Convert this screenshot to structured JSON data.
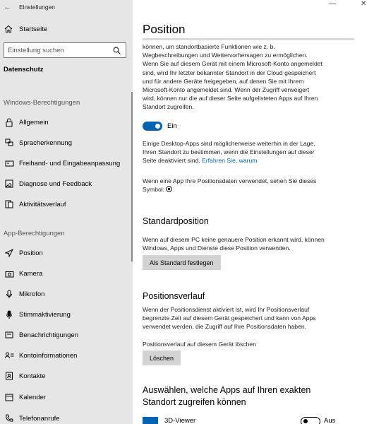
{
  "window": {
    "title": "Einstellungen"
  },
  "sidebar": {
    "home_label": "Startseite",
    "search_placeholder": "Einstellung suchen",
    "current_section": "Datenschutz",
    "group_windows": "Windows-Berechtigungen",
    "windows_items": [
      {
        "label": "Allgemein",
        "icon": "lock-icon"
      },
      {
        "label": "Spracherkennung",
        "icon": "speech-icon"
      },
      {
        "label": "Freihand- und Eingabeanpassung",
        "icon": "pen-icon"
      },
      {
        "label": "Diagnose und Feedback",
        "icon": "diagnostics-icon"
      },
      {
        "label": "Aktivitätsverlauf",
        "icon": "history-icon"
      }
    ],
    "group_apps": "App-Berechtigungen",
    "app_items": [
      {
        "label": "Position",
        "icon": "location-icon"
      },
      {
        "label": "Kamera",
        "icon": "camera-icon"
      },
      {
        "label": "Mikrofon",
        "icon": "microphone-icon"
      },
      {
        "label": "Stimmaktivierung",
        "icon": "voice-icon"
      },
      {
        "label": "Benachrichtigungen",
        "icon": "notification-icon"
      },
      {
        "label": "Kontoinformationen",
        "icon": "account-info-icon"
      },
      {
        "label": "Kontakte",
        "icon": "contacts-icon"
      },
      {
        "label": "Kalender",
        "icon": "calendar-icon"
      },
      {
        "label": "Telefonanrufe",
        "icon": "phone-icon"
      }
    ]
  },
  "content": {
    "title": "Position",
    "intro_lines": [
      "können, um standortbasierte Funktionen wie z. b.",
      "Wegbeschreibungen und Wettervorhersagen zu ermöglichen.",
      "Wenn Sie auf diesem Gerät mit einem Microsoft-Konto angemeldet",
      "sind, wird Ihr letzter bekannter Standort in der Cloud gespeichert",
      "und für andere Geräte freigegeben, auf denen Sie mit Ihrem",
      "Microsoft-Konto angemeldet sind. Wenn der Zugriff verweigert",
      "wird, können nur die auf dieser Seite aufgelisteten Apps auf Ihren",
      "Standort zugreifen."
    ],
    "toggle_label": "Ein",
    "toggle_on": true,
    "desktop_lines": [
      "Einige Desktop-Apps sind möglicherweise weiterhin in der Lage,",
      "Ihren Standort zu bestimmen, wenn die Einstellungen auf dieser"
    ],
    "desktop_last": "Seite deaktiviert sind.",
    "desktop_link": "Erfahren Sie, warum",
    "symbol_line1": "Wenn eine App Ihre Positionsdaten verwendet, sehen Sie dieses",
    "symbol_line2": "Symbol:",
    "std_heading": "Standardposition",
    "std_lines": [
      "Wenn auf diesem PC keine genauere Position erkannt wird, können",
      "Windows, Apps und Dienste diese Position verwenden."
    ],
    "std_button": "Als Standard festlegen",
    "hist_heading": "Positionsverlauf",
    "hist_lines": [
      "Wenn der Positionsdienst aktiviert ist, wird Ihr Positionsverlauf",
      "begrenzte Zeit auf diesem Gerät gespeichert und kann von Apps",
      "verwendet werden, die Zugriff auf Ihre Positionsdaten haben."
    ],
    "hist_clear_label": "Positionsverlauf auf diesem Gerät löschen",
    "hist_button": "Löschen",
    "apps_heading_1": "Auswählen, welche Apps auf Ihren exakten",
    "apps_heading_2": "Standort zugreifen können",
    "app_row": {
      "name": "3D-Viewer",
      "state": "Aus"
    }
  },
  "colors": {
    "accent": "#0063b1",
    "sidebar_bg": "#e6e6e6",
    "button_bg": "#d3d3d3"
  }
}
